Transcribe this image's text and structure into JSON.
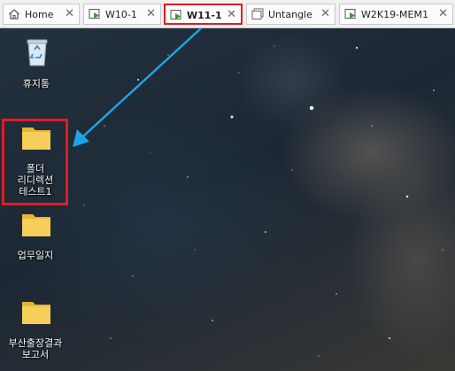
{
  "tabs": [
    {
      "label": "Home",
      "icon": "home-icon"
    },
    {
      "label": "W10-1",
      "icon": "vm-running-icon"
    },
    {
      "label": "W11-1",
      "icon": "vm-running-icon",
      "highlighted": true
    },
    {
      "label": "Untangle",
      "icon": "vm-stopped-icon"
    },
    {
      "label": "W2K19-MEM1",
      "icon": "vm-running-icon"
    }
  ],
  "desktop_icons": [
    {
      "label": "휴지통",
      "icon": "recycle-bin-icon"
    },
    {
      "label_lines": [
        "폴더",
        "리디렉션",
        "테스트1"
      ],
      "icon": "folder-icon",
      "highlighted": true
    },
    {
      "label": "업무일지",
      "icon": "folder-icon"
    },
    {
      "label_lines": [
        "부산출장결과",
        "보고서"
      ],
      "icon": "folder-icon"
    }
  ],
  "colors": {
    "highlight": "#e31b23",
    "arrow": "#1fa3e6",
    "vm_green": "#3a9a2c"
  }
}
